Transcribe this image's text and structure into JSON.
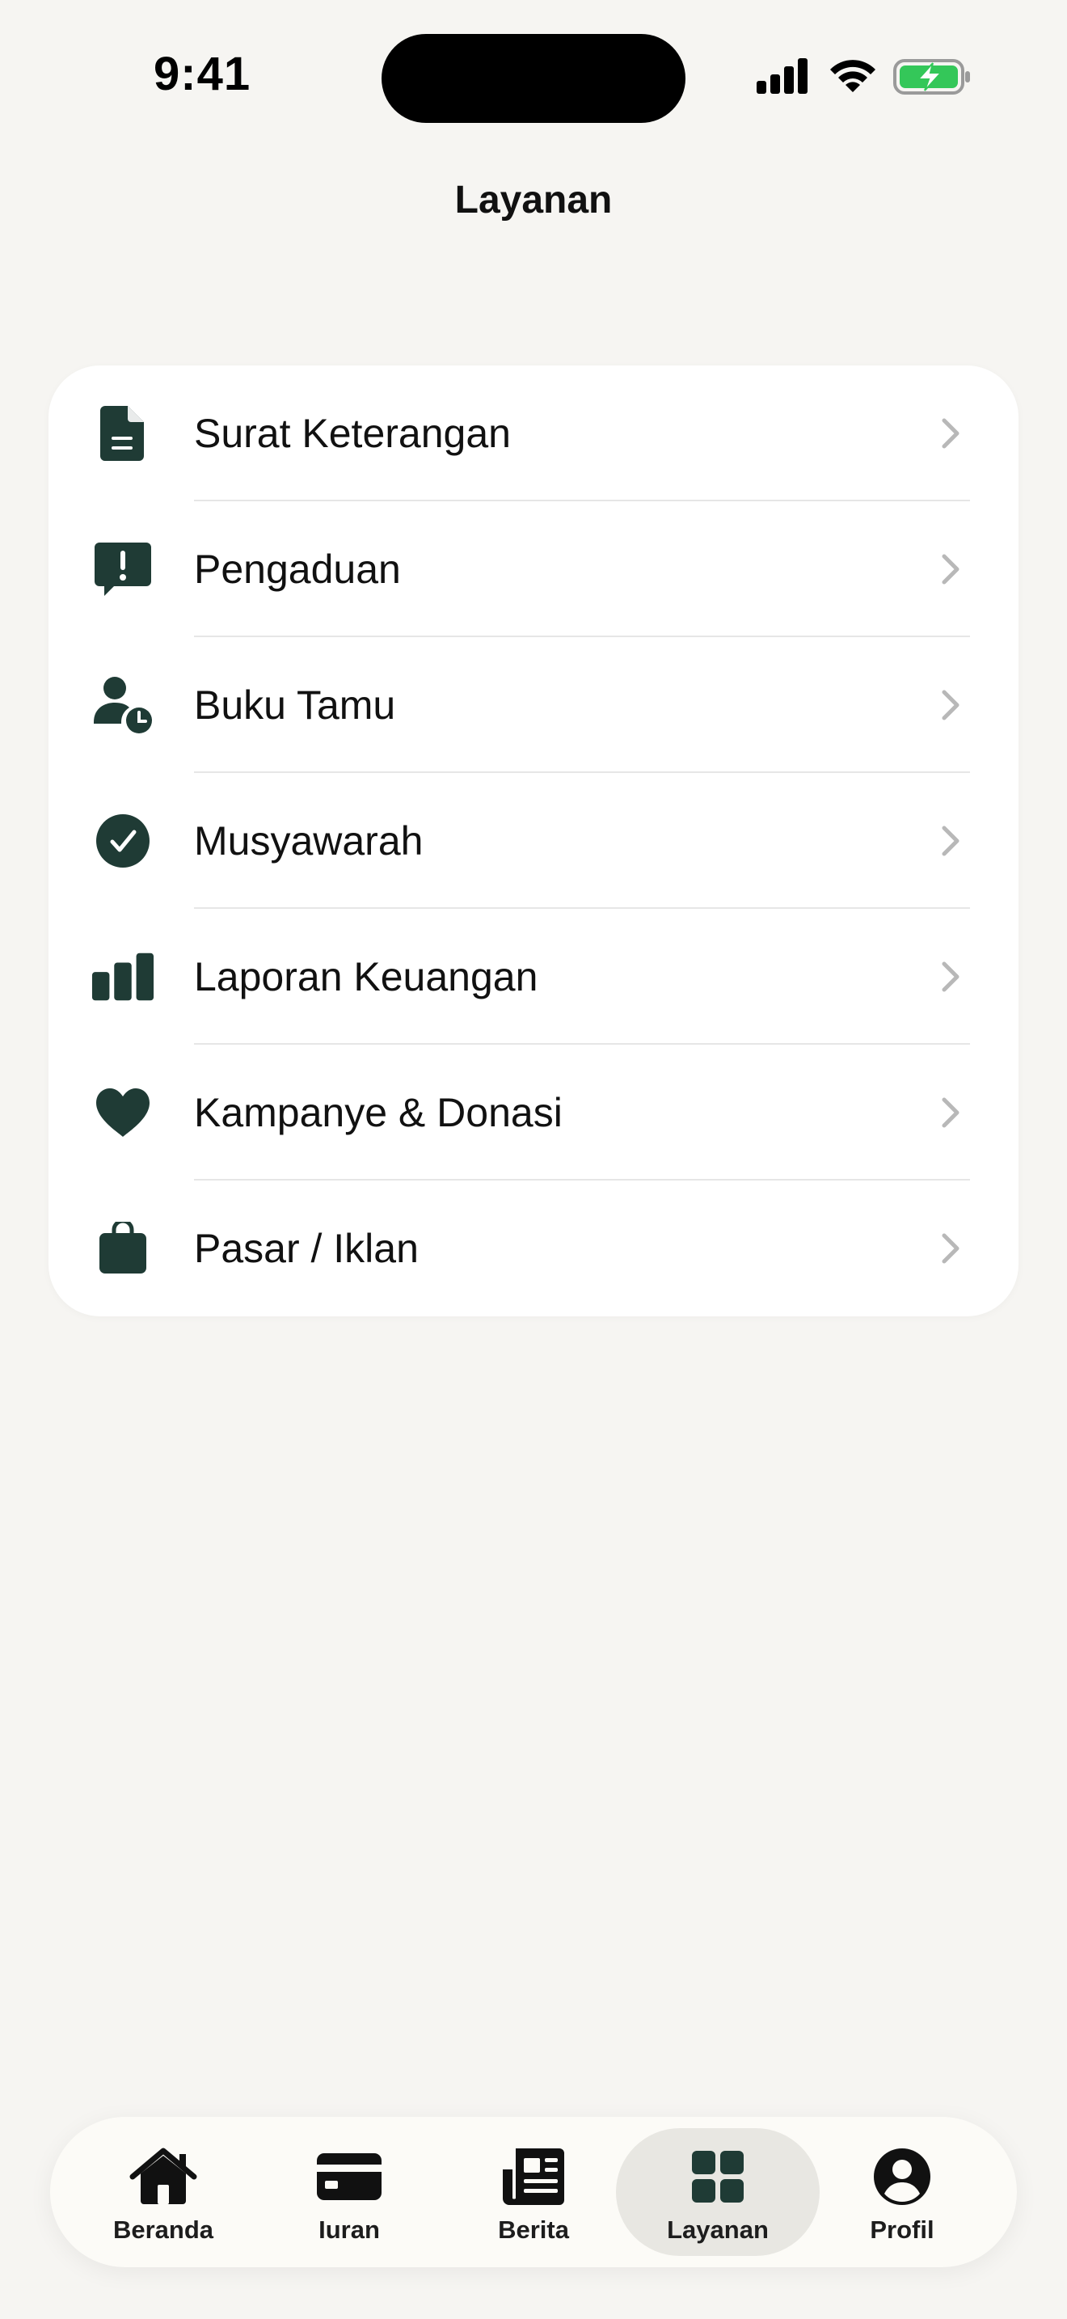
{
  "status_bar": {
    "time": "9:41"
  },
  "header": {
    "title": "Layanan"
  },
  "menu": {
    "items": [
      {
        "label": "Surat Keterangan",
        "icon": "document-icon"
      },
      {
        "label": "Pengaduan",
        "icon": "complaint-icon"
      },
      {
        "label": "Buku Tamu",
        "icon": "guest-book-icon"
      },
      {
        "label": "Musyawarah",
        "icon": "check-circle-icon"
      },
      {
        "label": "Laporan Keuangan",
        "icon": "bar-chart-icon"
      },
      {
        "label": "Kampanye & Donasi",
        "icon": "heart-icon"
      },
      {
        "label": "Pasar / Iklan",
        "icon": "shopping-bag-icon"
      }
    ]
  },
  "tab_bar": {
    "tabs": [
      {
        "label": "Beranda",
        "icon": "home-icon",
        "active": false
      },
      {
        "label": "Iuran",
        "icon": "card-icon",
        "active": false
      },
      {
        "label": "Berita",
        "icon": "newspaper-icon",
        "active": false
      },
      {
        "label": "Layanan",
        "icon": "grid-icon",
        "active": true
      },
      {
        "label": "Profil",
        "icon": "profile-icon",
        "active": false
      }
    ]
  },
  "colors": {
    "background": "#f6f5f2",
    "icon_primary": "#1f3b35",
    "battery_fill": "#34c759"
  }
}
